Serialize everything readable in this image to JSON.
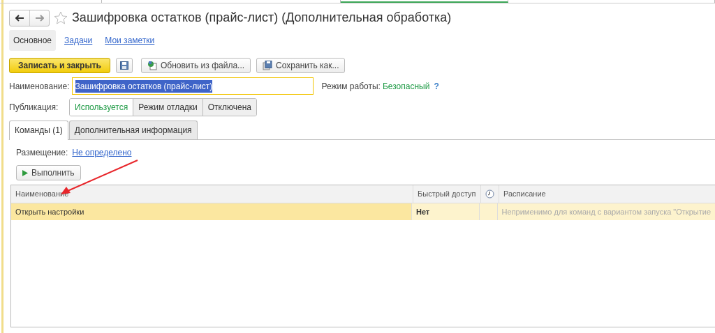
{
  "window": {
    "title": "Зашифровка остатков (прайс-лист) (Дополнительная обработка)",
    "favorite": false
  },
  "section_tabs": [
    {
      "label": "Основное",
      "selected": true
    },
    {
      "label": "Задачи",
      "selected": false
    },
    {
      "label": "Мои заметки",
      "selected": false
    }
  ],
  "toolbar": [
    {
      "kind": "primary",
      "label": "Записать и закрыть"
    },
    {
      "kind": "save"
    },
    {
      "kind": "update",
      "label": "Обновить из файла..."
    },
    {
      "kind": "saveas",
      "label": "Сохранить как..."
    }
  ],
  "name_field": {
    "label": "Наименование:",
    "value": "Зашифровка остатков (прайс-лист)",
    "text_selected": true
  },
  "mode": {
    "label": "Режим работы:",
    "value": "Безопасный",
    "help": "?"
  },
  "publication": {
    "label": "Публикация:",
    "options": [
      {
        "label": "Используется",
        "selected": true
      },
      {
        "label": "Режим отладки",
        "selected": false
      },
      {
        "label": "Отключена",
        "selected": false
      }
    ]
  },
  "tabs": [
    {
      "label": "Команды (1)",
      "selected": true
    },
    {
      "label": "Дополнительная информация",
      "selected": false
    }
  ],
  "placement": {
    "label": "Размещение:",
    "link": "Не определено"
  },
  "run_button": {
    "label": "Выполнить"
  },
  "table": {
    "columns": [
      {
        "kind": "text",
        "label": "Наименование"
      },
      {
        "kind": "text",
        "label": "Быстрый доступ"
      },
      {
        "kind": "clock"
      },
      {
        "kind": "text",
        "label": "Расписание"
      }
    ],
    "rows": [
      {
        "name": "Открыть настройки",
        "quick_access": "Нет",
        "schedule": "Неприменимо для команд с вариантом запуска \"Открытие",
        "selected": true
      }
    ]
  }
}
